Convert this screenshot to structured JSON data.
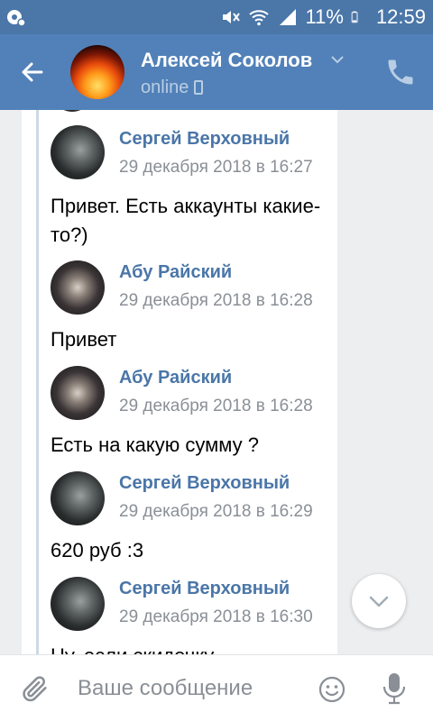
{
  "status_bar": {
    "battery_percent": "11%",
    "time": "12:59",
    "icons": [
      "notification-icon",
      "mute-icon",
      "wifi-icon",
      "signal-icon",
      "battery-icon"
    ]
  },
  "header": {
    "title": "Алексей Соколов",
    "status": "online",
    "icons": [
      "back-arrow-icon",
      "chevron-down-icon",
      "mobile-phone-icon",
      "call-icon"
    ]
  },
  "messages": [
    {
      "author": "Сергей Верховный",
      "time": "29 декабря 2018 в 16:27",
      "text": "Привет. Есть аккаунты какие-то?)"
    },
    {
      "author": "Абу Райский",
      "time": "29 декабря 2018 в 16:28",
      "text": "Привет"
    },
    {
      "author": "Абу Райский",
      "time": "29 декабря 2018 в 16:28",
      "text": "Есть на какую сумму ?"
    },
    {
      "author": "Сергей Верховный",
      "time": "29 декабря 2018 в 16:29",
      "text": "620 руб :3"
    },
    {
      "author": "Сергей Верховный",
      "time": "29 декабря 2018 в 16:30",
      "text": "Ну, если скидочку"
    }
  ],
  "composer": {
    "placeholder": "Ваше сообщение",
    "icons": [
      "attach-icon",
      "emoji-icon",
      "microphone-icon"
    ]
  },
  "colors": {
    "status_bar": "#4a76a8",
    "header": "#5181b8",
    "author_name": "#4a76a8",
    "background": "#edeef0"
  }
}
